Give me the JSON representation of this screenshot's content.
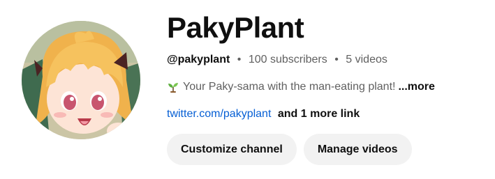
{
  "channel": {
    "name": "PakyPlant",
    "handle": "@pakyplant",
    "separator": "•",
    "subscribers": "100 subscribers",
    "videos": "5 videos"
  },
  "description": {
    "icon": "sprout-emoji",
    "text": "Your Paky-sama with the man-eating plant!",
    "more_label": "...more"
  },
  "links": {
    "primary": "twitter.com/pakyplant",
    "extra": "and 1 more link"
  },
  "buttons": {
    "customize": "Customize channel",
    "manage": "Manage videos"
  },
  "colors": {
    "link": "#065fd4",
    "button_bg": "#f2f2f2",
    "secondary_text": "#606060"
  }
}
